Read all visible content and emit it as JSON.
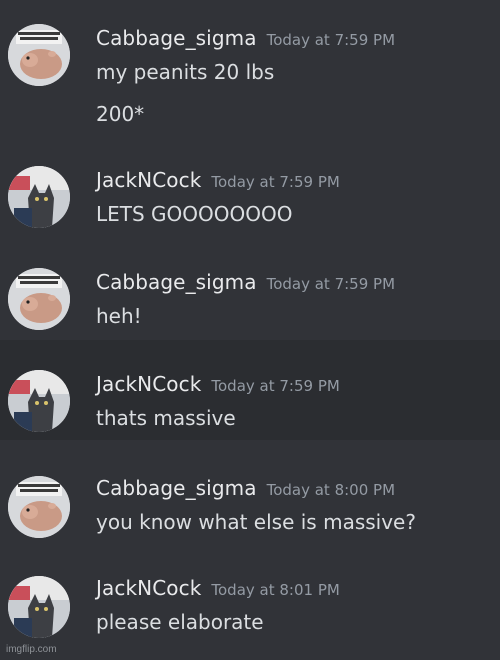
{
  "messages": [
    {
      "username": "Cabbage_sigma",
      "timestamp": "Today at 7:59 PM",
      "avatar": "hamster-avatar",
      "lines": [
        "my peanits 20 lbs",
        "200*"
      ]
    },
    {
      "username": "JackNCock",
      "timestamp": "Today at 7:59 PM",
      "avatar": "cat-avatar",
      "lines": [
        "LETS GOOOOOOOO"
      ]
    },
    {
      "username": "Cabbage_sigma",
      "timestamp": "Today at 7:59 PM",
      "avatar": "hamster-avatar",
      "lines": [
        "heh!"
      ]
    },
    {
      "username": "JackNCock",
      "timestamp": "Today at 7:59 PM",
      "avatar": "cat-avatar",
      "lines": [
        "thats massive"
      ]
    },
    {
      "username": "Cabbage_sigma",
      "timestamp": "Today at 8:00 PM",
      "avatar": "hamster-avatar",
      "lines": [
        "you know what else is massive?"
      ]
    },
    {
      "username": "JackNCock",
      "timestamp": "Today at 8:01 PM",
      "avatar": "cat-avatar",
      "lines": [
        "please elaborate"
      ]
    }
  ],
  "watermark": "imgflip.com",
  "colors": {
    "background": "#313338",
    "alt_background": "#2b2d31",
    "username": "#e9eaec",
    "timestamp": "#949ba4",
    "message_text": "#dbdee1"
  }
}
